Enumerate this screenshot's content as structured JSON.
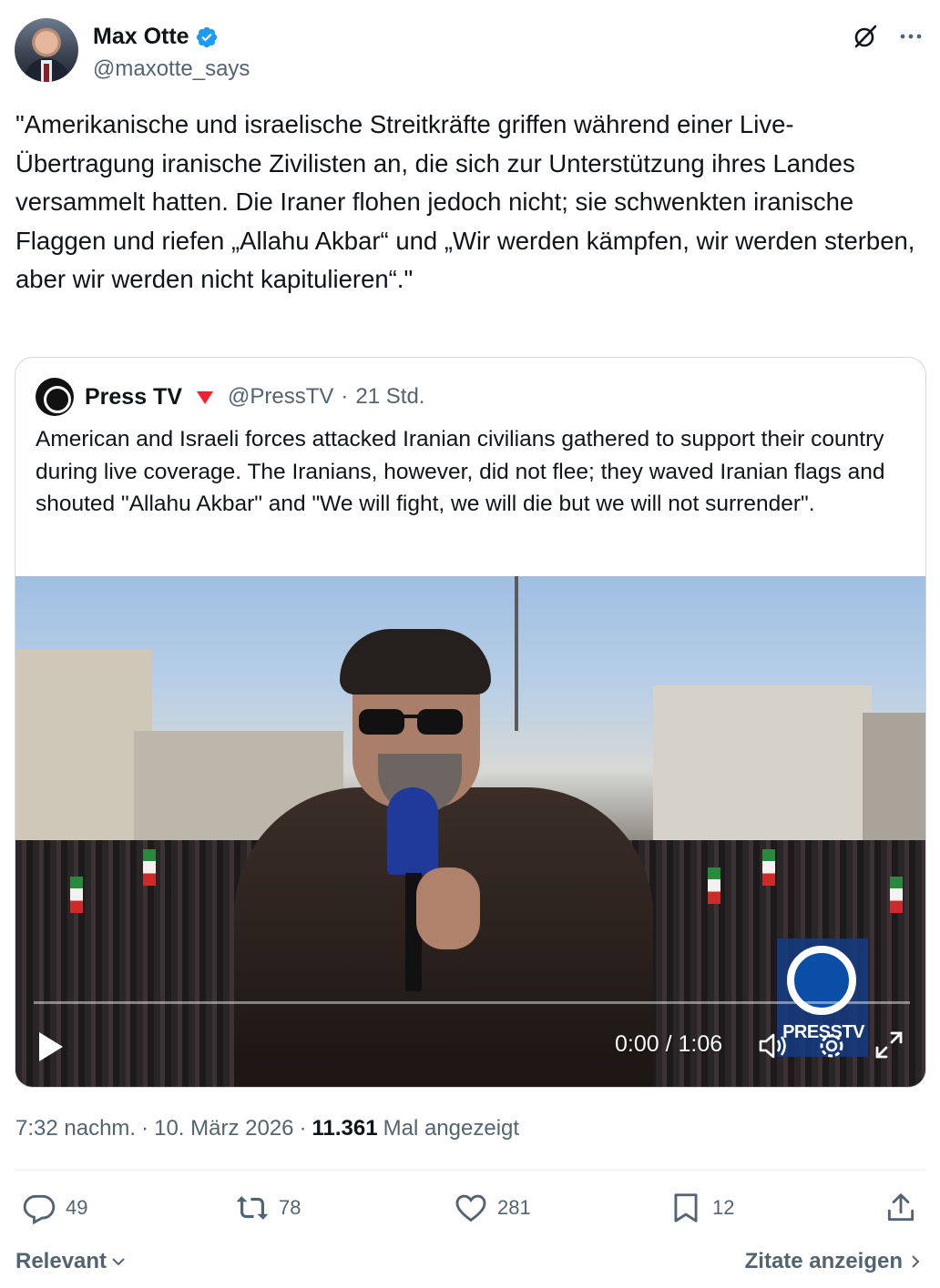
{
  "author": {
    "name": "Max Otte",
    "handle": "@maxotte_says",
    "verified_color": "#1d9bf0"
  },
  "tweet": {
    "text": "\"Amerikanische und israelische Streitkräfte griffen während einer Live-Übertragung iranische Zivilisten an, die sich zur Unterstützung ihres Landes versammelt hatten. Die Iraner flohen jedoch nicht; sie schwenkten iranische Flaggen und riefen „Allahu Akbar“ und „Wir werden kämpfen, wir werden sterben, aber wir werden nicht kapitulieren“.\""
  },
  "quote": {
    "name": "Press TV",
    "handle": "@PressTV",
    "separator": "·",
    "age": "21 Std.",
    "text": "American and Israeli forces attacked Iranian civilians gathered to support their country during live coverage. The Iranians, however, did not flee; they waved Iranian flags and shouted \"Allahu Akbar\" and \"We will fight, we will die but we will not surrender\".",
    "video": {
      "time": "0:00 / 1:06",
      "progress": 0.0,
      "overlay_logo_text": "PRESSTV"
    }
  },
  "meta": {
    "time": "7:32 nachm.",
    "sep1": "·",
    "date": "10. März 2026",
    "sep2": "·",
    "views": "11.361",
    "views_label": "Mal angezeigt"
  },
  "actions": {
    "replies": "49",
    "reposts": "78",
    "likes": "281",
    "bookmarks": "12"
  },
  "footer": {
    "sort_label": "Relevant",
    "quotes_label": "Zitate anzeigen"
  },
  "icons": [
    "verified-badge-icon",
    "grok-icon",
    "more-icon",
    "state-affiliated-icon",
    "play-icon",
    "volume-icon",
    "settings-icon",
    "fullscreen-icon",
    "reply-icon",
    "repost-icon",
    "like-icon",
    "bookmark-icon",
    "share-icon",
    "chevron-down-icon",
    "chevron-right-icon"
  ]
}
